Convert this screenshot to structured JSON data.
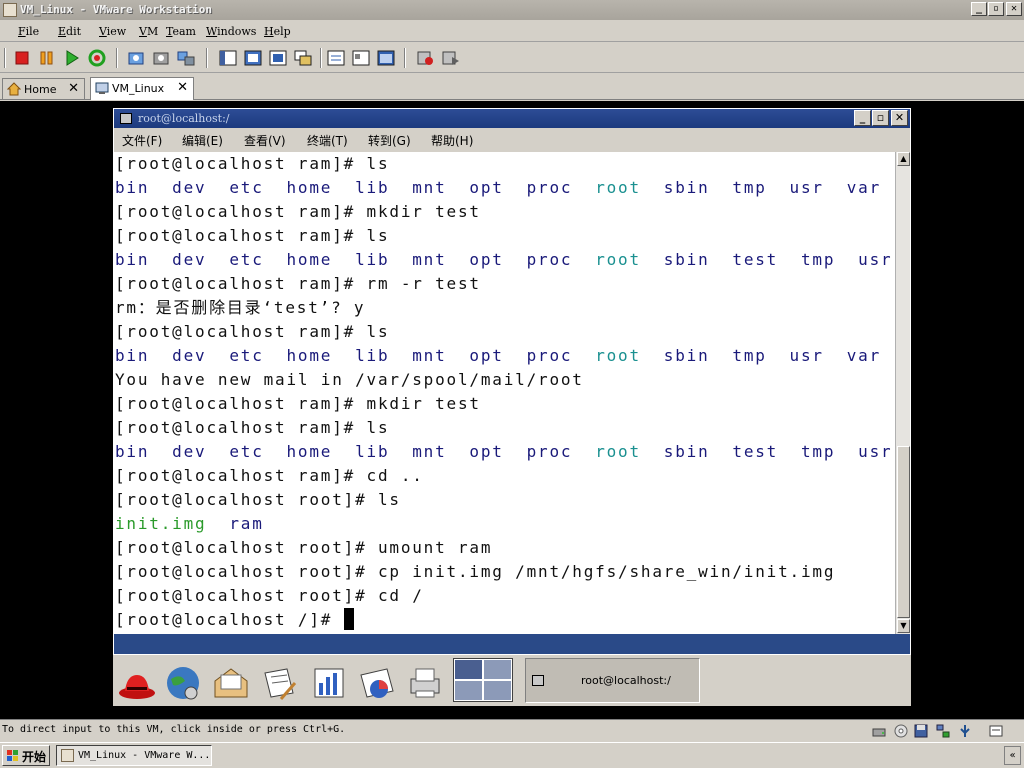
{
  "window": {
    "title": "VM_Linux - VMware Workstation",
    "minimize": "_",
    "maximize": "▫",
    "close": "✕"
  },
  "menu": [
    "File",
    "Edit",
    "View",
    "VM",
    "Team",
    "Windows",
    "Help"
  ],
  "tabs": [
    {
      "label": "Home",
      "close": "✕"
    },
    {
      "label": "VM_Linux",
      "close": "✕"
    }
  ],
  "guest": {
    "window_title": "root@localhost:/",
    "menu": [
      "文件(F)",
      "编辑(E)",
      "查看(V)",
      "终端(T)",
      "转到(G)",
      "帮助(H)"
    ],
    "terminal_lines": [
      [
        {
          "t": "[root@localhost ram]# ls",
          "c": ""
        }
      ],
      [
        {
          "t": "bin  dev  etc  home  lib  mnt  opt  proc  ",
          "c": "c-blue"
        },
        {
          "t": "root",
          "c": "c-cyan"
        },
        {
          "t": "  sbin  tmp  usr  var",
          "c": "c-blue"
        }
      ],
      [
        {
          "t": "[root@localhost ram]# mkdir test",
          "c": ""
        }
      ],
      [
        {
          "t": "[root@localhost ram]# ls",
          "c": ""
        }
      ],
      [
        {
          "t": "bin  dev  etc  home  lib  mnt  opt  proc  ",
          "c": "c-blue"
        },
        {
          "t": "root",
          "c": "c-cyan"
        },
        {
          "t": "  sbin  test  tmp  usr  var",
          "c": "c-blue"
        }
      ],
      [
        {
          "t": "[root@localhost ram]# rm -r test",
          "c": ""
        }
      ],
      [
        {
          "t": "rm：是否删除目录‘test’? y",
          "c": ""
        }
      ],
      [
        {
          "t": "[root@localhost ram]# ls",
          "c": ""
        }
      ],
      [
        {
          "t": "bin  dev  etc  home  lib  mnt  opt  proc  ",
          "c": "c-blue"
        },
        {
          "t": "root",
          "c": "c-cyan"
        },
        {
          "t": "  sbin  tmp  usr  var",
          "c": "c-blue"
        }
      ],
      [
        {
          "t": "You have new mail in /var/spool/mail/root",
          "c": ""
        }
      ],
      [
        {
          "t": "[root@localhost ram]# mkdir test",
          "c": ""
        }
      ],
      [
        {
          "t": "[root@localhost ram]# ls",
          "c": ""
        }
      ],
      [
        {
          "t": "bin  dev  etc  home  lib  mnt  opt  proc  ",
          "c": "c-blue"
        },
        {
          "t": "root",
          "c": "c-cyan"
        },
        {
          "t": "  sbin  test  tmp  usr  var",
          "c": "c-blue"
        }
      ],
      [
        {
          "t": "[root@localhost ram]# cd ..",
          "c": ""
        }
      ],
      [
        {
          "t": "[root@localhost root]# ls",
          "c": ""
        }
      ],
      [
        {
          "t": "init.img",
          "c": "c-green"
        },
        {
          "t": "  ram",
          "c": "c-blue"
        }
      ],
      [
        {
          "t": "[root@localhost root]# umount ram",
          "c": ""
        }
      ],
      [
        {
          "t": "[root@localhost root]# cp init.img /mnt/hgfs/share_win/init.img",
          "c": ""
        }
      ],
      [
        {
          "t": "[root@localhost root]# cd /",
          "c": ""
        }
      ],
      [
        {
          "t": "[root@localhost /]# ",
          "c": ""
        }
      ]
    ],
    "taskbar_item": "root@localhost:/",
    "panel_icons": [
      "redhat-icon",
      "web-browser-icon",
      "mail-icon",
      "writer-icon",
      "spreadsheet-icon",
      "presentation-icon",
      "printer-icon"
    ]
  },
  "status": {
    "message": "To direct input to this VM, click inside or press Ctrl+G."
  },
  "taskbar": {
    "start": "开始",
    "task": "VM_Linux - VMware W...",
    "tray_arrow": "«"
  },
  "colors": {
    "titlebar": "#1c3a7e",
    "term_blue": "#1a1a7a",
    "term_cyan": "#1a9090",
    "term_green": "#2a9a2a"
  }
}
